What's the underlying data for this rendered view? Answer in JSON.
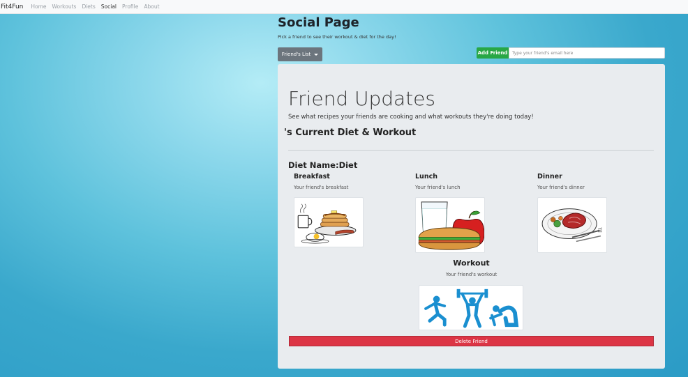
{
  "nav": {
    "brand": "Fit4Fun",
    "links": [
      "Home",
      "Workouts",
      "Diets",
      "Social",
      "Profile",
      "About"
    ],
    "active": "Social"
  },
  "header": {
    "title": "Social Page",
    "subtitle": "Pick a friend to see their workout & diet for the day!"
  },
  "friends_dropdown": {
    "label": "Friend's List"
  },
  "add_friend": {
    "button_label": "Add Friend",
    "input_placeholder": "Type your friend's email here",
    "input_value": ""
  },
  "card": {
    "title": "Friend Updates",
    "subtitle": "See what recipes your friends are cooking and what workouts they're doing today!",
    "current_heading": "'s Current Diet & Workout",
    "diet_label": "Diet Name:",
    "diet_value": "Diet",
    "meals": [
      {
        "title": "Breakfast",
        "desc": "Your friend's breakfast",
        "icon": "breakfast-image"
      },
      {
        "title": "Lunch",
        "desc": "Your friend's lunch",
        "icon": "lunch-image"
      },
      {
        "title": "Dinner",
        "desc": "Your friend's dinner",
        "icon": "dinner-image"
      }
    ],
    "workout": {
      "title": "Workout",
      "desc": "Your friend's workout",
      "icon": "workout-image"
    },
    "delete_label": "Delete Friend"
  },
  "colors": {
    "success": "#28a745",
    "danger": "#dc3545",
    "secondary": "#6c757d",
    "card_bg": "#e9ecef",
    "workout_icon": "#1a8fd0"
  }
}
